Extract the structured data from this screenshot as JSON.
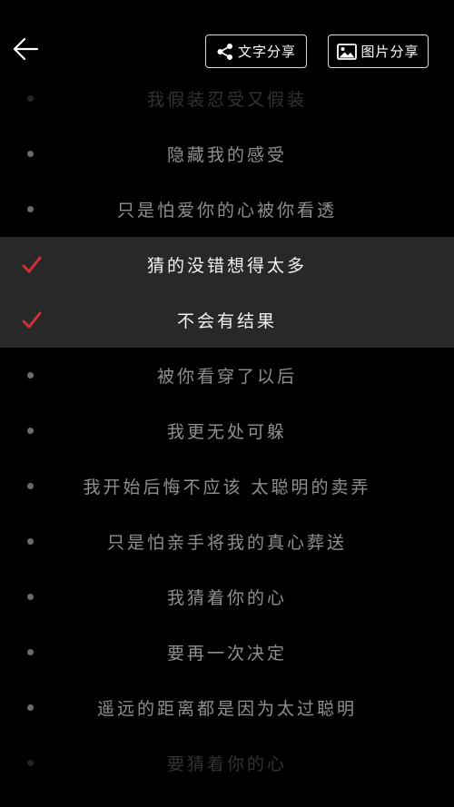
{
  "header": {
    "text_share_label": "文字分享",
    "image_share_label": "图片分享"
  },
  "colors": {
    "background": "#000000",
    "selected_row": "#282828",
    "check_accent": "#d1303a",
    "lyric_text": "#8f8f8f",
    "selected_text": "#f2f2f2"
  },
  "lyrics": [
    {
      "text": "我假装忍受又假装",
      "selected": false,
      "faded": true
    },
    {
      "text": "隐藏我的感受",
      "selected": false,
      "faded": false
    },
    {
      "text": "只是怕爱你的心被你看透",
      "selected": false,
      "faded": false
    },
    {
      "text": "猜的没错想得太多",
      "selected": true,
      "faded": false
    },
    {
      "text": "不会有结果",
      "selected": true,
      "faded": false
    },
    {
      "text": "被你看穿了以后",
      "selected": false,
      "faded": false
    },
    {
      "text": "我更无处可躲",
      "selected": false,
      "faded": false
    },
    {
      "text": "我开始后悔不应该 太聪明的卖弄",
      "selected": false,
      "faded": false
    },
    {
      "text": "只是怕亲手将我的真心葬送",
      "selected": false,
      "faded": false
    },
    {
      "text": "我猜着你的心",
      "selected": false,
      "faded": false
    },
    {
      "text": "要再一次决定",
      "selected": false,
      "faded": false
    },
    {
      "text": "遥远的距离都是因为太过聪明",
      "selected": false,
      "faded": false
    },
    {
      "text": "要猜着你的心",
      "selected": false,
      "faded": true
    }
  ]
}
